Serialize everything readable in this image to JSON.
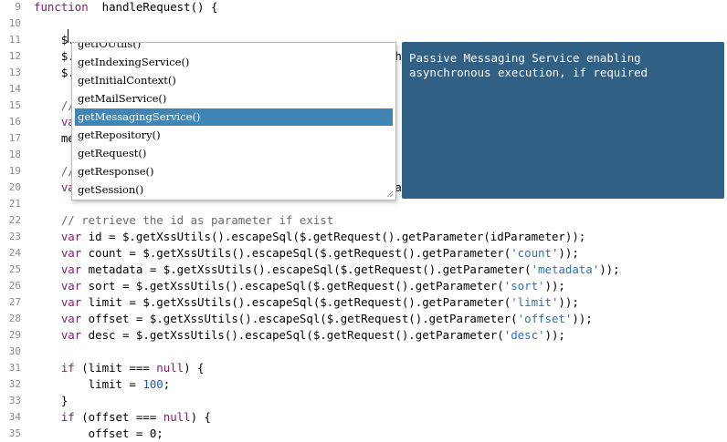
{
  "editor": {
    "lines": [
      {
        "n": "9",
        "segs": [
          [
            "kw",
            "function"
          ],
          [
            "",
            "  handleRequest() {"
          ]
        ]
      },
      {
        "n": "10",
        "segs": []
      },
      {
        "n": "11",
        "segs": [
          [
            "",
            "    $."
          ]
        ]
      },
      {
        "n": "12",
        "segs": [
          [
            "",
            "    $."
          ],
          [
            "",
            "                                              th"
          ]
        ]
      },
      {
        "n": "13",
        "segs": [
          [
            "",
            "    $."
          ]
        ]
      },
      {
        "n": "14",
        "segs": []
      },
      {
        "n": "15",
        "segs": [
          [
            "cmt",
            "    //"
          ]
        ]
      },
      {
        "n": "16",
        "segs": [
          [
            "kw",
            "    va"
          ]
        ]
      },
      {
        "n": "17",
        "segs": [
          [
            "",
            "    me"
          ]
        ]
      },
      {
        "n": "18",
        "segs": []
      },
      {
        "n": "19",
        "segs": [
          [
            "cmt",
            "    //"
          ]
        ]
      },
      {
        "n": "20",
        "segs": [
          [
            "kw",
            "    va"
          ],
          [
            "",
            "                                               ar"
          ]
        ]
      },
      {
        "n": "21",
        "segs": []
      },
      {
        "n": "22",
        "segs": [
          [
            "cmt",
            "    // retrieve the id as parameter if exist"
          ]
        ]
      },
      {
        "n": "23",
        "segs": [
          [
            "kw",
            "    var"
          ],
          [
            "",
            " id = $.getXssUtils().escapeSql($.getRequest().getParameter(idParameter));"
          ]
        ]
      },
      {
        "n": "24",
        "segs": [
          [
            "kw",
            "    var"
          ],
          [
            "",
            " count = $.getXssUtils().escapeSql($.getRequest().getParameter("
          ],
          [
            "str",
            "'count'"
          ],
          [
            "",
            "));"
          ]
        ]
      },
      {
        "n": "25",
        "segs": [
          [
            "kw",
            "    var"
          ],
          [
            "",
            " metadata = $.getXssUtils().escapeSql($.getRequest().getParameter("
          ],
          [
            "str",
            "'metadata'"
          ],
          [
            "",
            "));"
          ]
        ]
      },
      {
        "n": "26",
        "segs": [
          [
            "kw",
            "    var"
          ],
          [
            "",
            " sort = $.getXssUtils().escapeSql($.getRequest().getParameter("
          ],
          [
            "str",
            "'sort'"
          ],
          [
            "",
            "));"
          ]
        ]
      },
      {
        "n": "27",
        "segs": [
          [
            "kw",
            "    var"
          ],
          [
            "",
            " limit = $.getXssUtils().escapeSql($.getRequest().getParameter("
          ],
          [
            "str",
            "'limit'"
          ],
          [
            "",
            "));"
          ]
        ]
      },
      {
        "n": "28",
        "segs": [
          [
            "kw",
            "    var"
          ],
          [
            "",
            " offset = $.getXssUtils().escapeSql($.getRequest().getParameter("
          ],
          [
            "str",
            "'offset'"
          ],
          [
            "",
            "));"
          ]
        ]
      },
      {
        "n": "29",
        "segs": [
          [
            "kw",
            "    var"
          ],
          [
            "",
            " desc = $.getXssUtils().escapeSql($.getRequest().getParameter("
          ],
          [
            "str",
            "'desc'"
          ],
          [
            "",
            "));"
          ]
        ]
      },
      {
        "n": "30",
        "segs": []
      },
      {
        "n": "31",
        "segs": [
          [
            "kw",
            "    if"
          ],
          [
            "",
            " (limit === "
          ],
          [
            "kw",
            "null"
          ],
          [
            "",
            ") {"
          ]
        ]
      },
      {
        "n": "32",
        "segs": [
          [
            "",
            "        limit = "
          ],
          [
            "num",
            "100"
          ],
          [
            "",
            ";"
          ]
        ]
      },
      {
        "n": "33",
        "segs": [
          [
            "",
            "    }"
          ]
        ]
      },
      {
        "n": "34",
        "segs": [
          [
            "kw",
            "    if"
          ],
          [
            "",
            " (offset === "
          ],
          [
            "kw",
            "null"
          ],
          [
            "",
            ") {"
          ]
        ]
      },
      {
        "n": "35",
        "segs": [
          [
            "",
            "        offset = 0;"
          ]
        ]
      }
    ]
  },
  "autocomplete": {
    "items": [
      {
        "label": "getIOUtils()",
        "selected": false
      },
      {
        "label": "getIndexingService()",
        "selected": false
      },
      {
        "label": "getInitialContext()",
        "selected": false
      },
      {
        "label": "getMailService()",
        "selected": false
      },
      {
        "label": "getMessagingService()",
        "selected": true
      },
      {
        "label": "getRepository()",
        "selected": false
      },
      {
        "label": "getRequest()",
        "selected": false
      },
      {
        "label": "getResponse()",
        "selected": false
      },
      {
        "label": "getSession()",
        "selected": false
      }
    ],
    "doc": "Passive Messaging Service enabling asynchronous execution, if required"
  },
  "colors": {
    "keyword": "#8b1a6b",
    "selection": "#3f86b4",
    "doc_panel": "#325f84"
  }
}
